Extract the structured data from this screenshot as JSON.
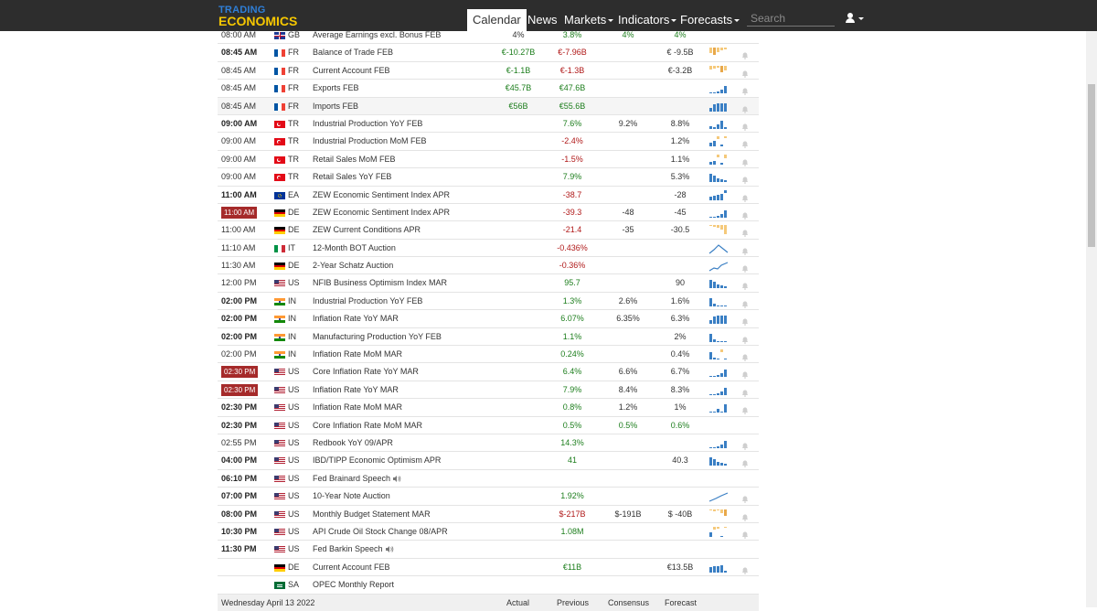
{
  "header": {
    "logo_top": "TRADING",
    "logo_bottom": "ECONOMICS",
    "nav": [
      {
        "label": "Calendar",
        "active": true
      },
      {
        "label": "News"
      },
      {
        "label": "Markets",
        "dropdown": true
      },
      {
        "label": "Indicators",
        "dropdown": true
      },
      {
        "label": "Forecasts",
        "dropdown": true
      }
    ],
    "search_placeholder": "Search"
  },
  "rows": [
    {
      "time": "08:00 AM",
      "time_style": "normal",
      "flag": "GB",
      "cc": "GB",
      "event": "Average Earnings excl. Bonus FEB",
      "actual": "4%",
      "actual_color": "plain",
      "previous": "3.8%",
      "previous_color": "pos",
      "consensus": "4%",
      "consensus_color": "pos",
      "forecast": "4%",
      "forecast_color": "pos",
      "chart": "none",
      "bell": false,
      "shaded": false
    },
    {
      "time": "08:45 AM",
      "time_style": "bold",
      "flag": "FR",
      "cc": "FR",
      "event": "Balance of Trade FEB",
      "actual": "€-10.27B",
      "actual_color": "pos",
      "previous": "€-7.96B",
      "previous_color": "neg",
      "consensus": "",
      "forecast": "€ -9.5B",
      "forecast_color": "plain",
      "chart": "bars-orange-a",
      "bell": true,
      "shaded": false
    },
    {
      "time": "08:45 AM",
      "time_style": "normal",
      "flag": "FR",
      "cc": "FR",
      "event": "Current Account FEB",
      "actual": "€-1.1B",
      "actual_color": "pos",
      "previous": "€-1.3B",
      "previous_color": "neg",
      "consensus": "",
      "forecast": "€-3.2B",
      "forecast_color": "plain",
      "chart": "bars-orange-b",
      "bell": true,
      "shaded": false
    },
    {
      "time": "08:45 AM",
      "time_style": "normal",
      "flag": "FR",
      "cc": "FR",
      "event": "Exports FEB",
      "actual": "€45.7B",
      "actual_color": "pos",
      "previous": "€47.6B",
      "previous_color": "pos",
      "consensus": "",
      "forecast": "",
      "forecast_color": "plain",
      "chart": "bars-blue-rise",
      "bell": true,
      "shaded": false
    },
    {
      "time": "08:45 AM",
      "time_style": "normal",
      "flag": "FR",
      "cc": "FR",
      "event": "Imports FEB",
      "actual": "€56B",
      "actual_color": "pos",
      "previous": "€55.6B",
      "previous_color": "pos",
      "consensus": "",
      "forecast": "",
      "forecast_color": "plain",
      "chart": "bars-blue-full",
      "bell": true,
      "shaded": true
    },
    {
      "time": "09:00 AM",
      "time_style": "bold",
      "flag": "TR",
      "cc": "TR",
      "event": "Industrial Production YoY FEB",
      "actual": "",
      "previous": "7.6%",
      "previous_color": "pos",
      "consensus": "9.2%",
      "consensus_color": "plain",
      "forecast": "8.8%",
      "forecast_color": "plain",
      "chart": "bars-blue-mix",
      "bell": true,
      "shaded": false
    },
    {
      "time": "09:00 AM",
      "time_style": "normal",
      "flag": "TR",
      "cc": "TR",
      "event": "Industrial Production MoM FEB",
      "actual": "",
      "previous": "-2.4%",
      "previous_color": "neg",
      "consensus": "",
      "forecast": "1.2%",
      "forecast_color": "plain",
      "chart": "bars-mom",
      "bell": true,
      "shaded": false
    },
    {
      "time": "09:00 AM",
      "time_style": "normal",
      "flag": "TR",
      "cc": "TR",
      "event": "Retail Sales MoM FEB",
      "actual": "",
      "previous": "-1.5%",
      "previous_color": "neg",
      "consensus": "",
      "forecast": "1.1%",
      "forecast_color": "plain",
      "chart": "bars-mom-b",
      "bell": true,
      "shaded": false
    },
    {
      "time": "09:00 AM",
      "time_style": "normal",
      "flag": "TR",
      "cc": "TR",
      "event": "Retail Sales YoY FEB",
      "actual": "",
      "previous": "7.9%",
      "previous_color": "pos",
      "consensus": "",
      "forecast": "5.3%",
      "forecast_color": "plain",
      "chart": "bars-blue-fall",
      "bell": true,
      "shaded": false
    },
    {
      "time": "11:00 AM",
      "time_style": "bold",
      "flag": "EA",
      "cc": "EA",
      "event": "ZEW Economic Sentiment Index APR",
      "actual": "",
      "previous": "-38.7",
      "previous_color": "neg",
      "consensus": "",
      "forecast": "-28",
      "forecast_color": "plain",
      "chart": "bars-zew",
      "bell": true,
      "shaded": false
    },
    {
      "time": "11:00 AM",
      "time_style": "live",
      "flag": "DE",
      "cc": "DE",
      "event": "ZEW Economic Sentiment Index APR",
      "actual": "",
      "previous": "-39.3",
      "previous_color": "neg",
      "consensus": "-48",
      "consensus_color": "plain",
      "forecast": "-45",
      "forecast_color": "plain",
      "chart": "bars-blue-rise",
      "bell": true,
      "shaded": false
    },
    {
      "time": "11:00 AM",
      "time_style": "normal",
      "flag": "DE",
      "cc": "DE",
      "event": "ZEW Current Conditions APR",
      "actual": "",
      "previous": "-21.4",
      "previous_color": "neg",
      "consensus": "-35",
      "consensus_color": "plain",
      "forecast": "-30.5",
      "forecast_color": "plain",
      "chart": "bars-orange-c",
      "bell": true,
      "shaded": false
    },
    {
      "time": "11:10 AM",
      "time_style": "normal",
      "flag": "IT",
      "cc": "IT",
      "event": "12-Month BOT Auction",
      "actual": "",
      "previous": "-0.436%",
      "previous_color": "neg",
      "consensus": "",
      "forecast": "",
      "forecast_color": "plain",
      "chart": "line-peak",
      "bell": true,
      "shaded": false
    },
    {
      "time": "11:30 AM",
      "time_style": "normal",
      "flag": "DE",
      "cc": "DE",
      "event": "2-Year Schatz Auction",
      "actual": "",
      "previous": "-0.36%",
      "previous_color": "neg",
      "consensus": "",
      "forecast": "",
      "forecast_color": "plain",
      "chart": "line-zig",
      "bell": true,
      "shaded": false
    },
    {
      "time": "12:00 PM",
      "time_style": "normal",
      "flag": "US",
      "cc": "US",
      "event": "NFIB Business Optimism Index MAR",
      "actual": "",
      "previous": "95.7",
      "previous_color": "pos",
      "consensus": "",
      "forecast": "90",
      "forecast_color": "plain",
      "chart": "bars-blue-fall",
      "bell": true,
      "shaded": false
    },
    {
      "time": "02:00 PM",
      "time_style": "bold",
      "flag": "IN",
      "cc": "IN",
      "event": "Industrial Production YoY FEB",
      "actual": "",
      "previous": "1.3%",
      "previous_color": "pos",
      "consensus": "2.6%",
      "consensus_color": "plain",
      "forecast": "1.6%",
      "forecast_color": "plain",
      "chart": "bars-blue-low",
      "bell": true,
      "shaded": false
    },
    {
      "time": "02:00 PM",
      "time_style": "bold",
      "flag": "IN",
      "cc": "IN",
      "event": "Inflation Rate YoY MAR",
      "actual": "",
      "previous": "6.07%",
      "previous_color": "pos",
      "consensus": "6.35%",
      "consensus_color": "plain",
      "forecast": "6.3%",
      "forecast_color": "plain",
      "chart": "bars-blue-full",
      "bell": true,
      "shaded": false
    },
    {
      "time": "02:00 PM",
      "time_style": "bold",
      "flag": "IN",
      "cc": "IN",
      "event": "Manufacturing Production YoY FEB",
      "actual": "",
      "previous": "1.1%",
      "previous_color": "pos",
      "consensus": "",
      "forecast": "2%",
      "forecast_color": "plain",
      "chart": "bars-blue-low",
      "bell": true,
      "shaded": false
    },
    {
      "time": "02:00 PM",
      "time_style": "normal",
      "flag": "IN",
      "cc": "IN",
      "event": "Inflation Rate MoM MAR",
      "actual": "",
      "previous": "0.24%",
      "previous_color": "pos",
      "consensus": "",
      "forecast": "0.4%",
      "forecast_color": "plain",
      "chart": "bars-mom-c",
      "bell": true,
      "shaded": false
    },
    {
      "time": "02:30 PM",
      "time_style": "live",
      "flag": "US",
      "cc": "US",
      "event": "Core Inflation Rate YoY MAR",
      "actual": "",
      "previous": "6.4%",
      "previous_color": "pos",
      "consensus": "6.6%",
      "consensus_color": "plain",
      "forecast": "6.7%",
      "forecast_color": "plain",
      "chart": "bars-blue-rise",
      "bell": true,
      "shaded": false
    },
    {
      "time": "02:30 PM",
      "time_style": "live",
      "flag": "US",
      "cc": "US",
      "event": "Inflation Rate YoY MAR",
      "actual": "",
      "previous": "7.9%",
      "previous_color": "pos",
      "consensus": "8.4%",
      "consensus_color": "plain",
      "forecast": "8.3%",
      "forecast_color": "plain",
      "chart": "bars-blue-rise",
      "bell": true,
      "shaded": false
    },
    {
      "time": "02:30 PM",
      "time_style": "bold",
      "flag": "US",
      "cc": "US",
      "event": "Inflation Rate MoM MAR",
      "actual": "",
      "previous": "0.8%",
      "previous_color": "pos",
      "consensus": "1.2%",
      "consensus_color": "plain",
      "forecast": "1%",
      "forecast_color": "plain",
      "chart": "bars-blue-low2",
      "bell": true,
      "shaded": false
    },
    {
      "time": "02:30 PM",
      "time_style": "bold",
      "flag": "US",
      "cc": "US",
      "event": "Core Inflation Rate MoM MAR",
      "actual": "",
      "previous": "0.5%",
      "previous_color": "pos",
      "consensus": "0.5%",
      "consensus_color": "pos",
      "forecast": "0.6%",
      "forecast_color": "pos",
      "chart": "none",
      "bell": false,
      "shaded": false
    },
    {
      "time": "02:55 PM",
      "time_style": "normal",
      "flag": "US",
      "cc": "US",
      "event": "Redbook YoY 09/APR",
      "actual": "",
      "previous": "14.3%",
      "previous_color": "pos",
      "consensus": "",
      "forecast": "",
      "forecast_color": "plain",
      "chart": "bars-blue-rise",
      "bell": true,
      "shaded": false
    },
    {
      "time": "04:00 PM",
      "time_style": "bold",
      "flag": "US",
      "cc": "US",
      "event": "IBD/TIPP Economic Optimism APR",
      "actual": "",
      "previous": "41",
      "previous_color": "pos",
      "consensus": "",
      "forecast": "40.3",
      "forecast_color": "plain",
      "chart": "bars-blue-fall",
      "bell": true,
      "shaded": false
    },
    {
      "time": "06:10 PM",
      "time_style": "bold",
      "flag": "US",
      "cc": "US",
      "event": "Fed Brainard Speech",
      "speech": true,
      "actual": "",
      "previous": "",
      "consensus": "",
      "forecast": "",
      "chart": "none",
      "bell": false,
      "shaded": false
    },
    {
      "time": "07:00 PM",
      "time_style": "bold",
      "flag": "US",
      "cc": "US",
      "event": "10-Year Note Auction",
      "actual": "",
      "previous": "1.92%",
      "previous_color": "pos",
      "consensus": "",
      "forecast": "",
      "forecast_color": "plain",
      "chart": "line-rise",
      "bell": true,
      "shaded": false
    },
    {
      "time": "08:00 PM",
      "time_style": "bold",
      "flag": "US",
      "cc": "US",
      "event": "Monthly Budget Statement MAR",
      "actual": "",
      "previous": "$-217B",
      "previous_color": "neg",
      "consensus": "$-191B",
      "consensus_color": "plain",
      "forecast": "$ -40B",
      "forecast_color": "plain",
      "chart": "bars-orange-d",
      "bell": true,
      "shaded": false
    },
    {
      "time": "10:30 PM",
      "time_style": "bold",
      "flag": "US",
      "cc": "US",
      "event": "API Crude Oil Stock Change 08/APR",
      "actual": "",
      "previous": "1.08M",
      "previous_color": "pos",
      "consensus": "",
      "forecast": "",
      "forecast_color": "plain",
      "chart": "bars-mom-d",
      "bell": true,
      "shaded": false
    },
    {
      "time": "11:30 PM",
      "time_style": "bold",
      "flag": "US",
      "cc": "US",
      "event": "Fed Barkin Speech",
      "speech": true,
      "actual": "",
      "previous": "",
      "consensus": "",
      "forecast": "",
      "chart": "none",
      "bell": false,
      "shaded": false
    },
    {
      "time": "",
      "time_style": "normal",
      "flag": "DE",
      "cc": "DE",
      "event": "Current Account FEB",
      "actual": "",
      "previous": "€11B",
      "previous_color": "pos",
      "consensus": "",
      "forecast": "€13.5B",
      "forecast_color": "plain",
      "chart": "bars-blue-full2",
      "bell": true,
      "shaded": false
    },
    {
      "time": "",
      "time_style": "normal",
      "flag": "SA",
      "cc": "SA",
      "event": "OPEC Monthly Report",
      "actual": "",
      "previous": "",
      "consensus": "",
      "forecast": "",
      "chart": "none",
      "bell": false,
      "shaded": false
    }
  ],
  "footer": {
    "date": "Wednesday April 13 2022",
    "actual": "Actual",
    "previous": "Previous",
    "consensus": "Consensus",
    "forecast": "Forecast"
  },
  "colors": {
    "navbar": "#2d2d2d",
    "positive": "#1d7e1d",
    "negative": "#b01919",
    "live_badge": "#a52a2a",
    "chart_blue": "#3a7fc4",
    "chart_orange": "#f5c97a"
  }
}
